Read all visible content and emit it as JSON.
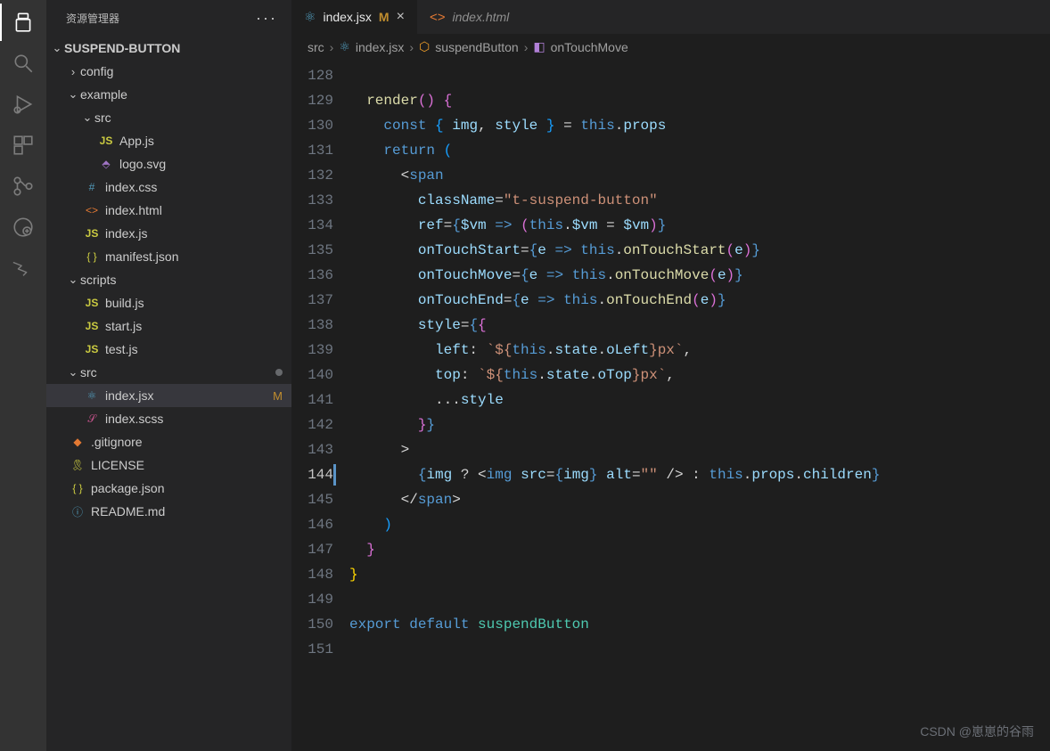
{
  "explorer": {
    "title": "资源管理器"
  },
  "project": "SUSPEND-BUTTON",
  "tree": {
    "config": "config",
    "example": "example",
    "src1": "src",
    "appjs": "App.js",
    "logosvg": "logo.svg",
    "indexcss": "index.css",
    "indexhtml": "index.html",
    "indexjs": "index.js",
    "manifest": "manifest.json",
    "scripts": "scripts",
    "build": "build.js",
    "start": "start.js",
    "test": "test.js",
    "src2": "src",
    "indexjsx": "index.jsx",
    "indexscss": "index.scss",
    "gitignore": ".gitignore",
    "license": "LICENSE",
    "packagejson": "package.json",
    "readme": "README.md"
  },
  "status": {
    "modified": "M"
  },
  "tabs": {
    "active": "index.jsx",
    "activeMod": "M",
    "inactive": "index.html"
  },
  "breadcrumb": {
    "src": "src",
    "file": "index.jsx",
    "class": "suspendButton",
    "method": "onTouchMove"
  },
  "code": {
    "startLine": 128,
    "endLine": 151,
    "cursorLine": 144
  },
  "watermark": "CSDN @崽崽的谷雨"
}
